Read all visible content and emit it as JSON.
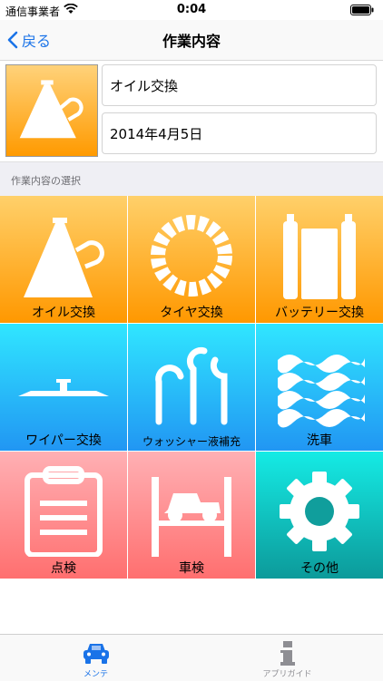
{
  "status_bar": {
    "carrier": "通信事業者",
    "time": "0:04"
  },
  "nav": {
    "back_label": "戻る",
    "title": "作業内容"
  },
  "header": {
    "selected_task": "オイル交換",
    "date": "2014年4月5日"
  },
  "section": {
    "label": "作業内容の選択"
  },
  "tiles": [
    {
      "label": "オイル交換",
      "icon": "oil-can-icon"
    },
    {
      "label": "タイヤ交換",
      "icon": "tire-icon"
    },
    {
      "label": "バッテリー交換",
      "icon": "battery-icon"
    },
    {
      "label": "ワイパー交換",
      "icon": "wiper-icon"
    },
    {
      "label": "ウォッシャー液補充",
      "icon": "washer-fluid-icon"
    },
    {
      "label": "洗車",
      "icon": "car-wash-waves-icon"
    },
    {
      "label": "点検",
      "icon": "clipboard-icon"
    },
    {
      "label": "車検",
      "icon": "car-lift-icon"
    },
    {
      "label": "その他",
      "icon": "gear-icon"
    }
  ],
  "tabs": [
    {
      "label": "メンテ",
      "icon": "car-icon",
      "selected": true
    },
    {
      "label": "アプリガイド",
      "icon": "info-icon",
      "selected": false
    }
  ],
  "colors": {
    "accent": "#1a73e8",
    "orange_top": "#ffd06a",
    "orange_bottom": "#ff9800",
    "blue_top": "#30e6ff",
    "blue_bottom": "#2196f3",
    "red_top": "#ffb0b4",
    "red_bottom": "#ff6f6f",
    "teal_top": "#15ebe5",
    "teal_bottom": "#0c9a9a"
  }
}
